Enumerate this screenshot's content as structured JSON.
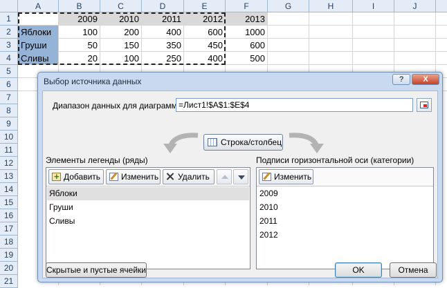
{
  "spreadsheet": {
    "columns": [
      "A",
      "B",
      "C",
      "D",
      "E",
      "F",
      "G",
      "H",
      "I",
      "J"
    ],
    "rows": [
      "1",
      "2",
      "3",
      "4",
      "5",
      "6",
      "7",
      "8",
      "9",
      "10",
      "11",
      "12",
      "13",
      "14",
      "15",
      "16",
      "17",
      "18",
      "19",
      "20",
      "21"
    ],
    "years": [
      "2009",
      "2010",
      "2011",
      "2012",
      "2013"
    ],
    "data_rows": [
      {
        "name": "Яблоки",
        "values": [
          "100",
          "200",
          "400",
          "600",
          "1000"
        ]
      },
      {
        "name": "Груши",
        "values": [
          "50",
          "150",
          "350",
          "450",
          "600"
        ]
      },
      {
        "name": "Сливы",
        "values": [
          "20",
          "100",
          "250",
          "400",
          "500"
        ]
      }
    ]
  },
  "dialog": {
    "title": "Выбор источника данных",
    "help": "?",
    "close": "X",
    "range_label": "Диапазон данных для диаграммы:",
    "range_value": "=Лист1!$A$1:$E$4",
    "switch_label": "Строка/столбец",
    "legend_label": "Элементы легенды (ряды)",
    "legend_buttons": {
      "add": "Добавить",
      "edit": "Изменить",
      "delete": "Удалить"
    },
    "legend_items": [
      "Яблоки",
      "Груши",
      "Сливы"
    ],
    "axis_label": "Подписи горизонтальной оси (категории)",
    "axis_edit": "Изменить",
    "axis_items": [
      "2009",
      "2010",
      "2011",
      "2012"
    ],
    "hidden_cells": "Скрытые и пустые ячейки",
    "ok": "OK",
    "cancel": "Отмена"
  }
}
